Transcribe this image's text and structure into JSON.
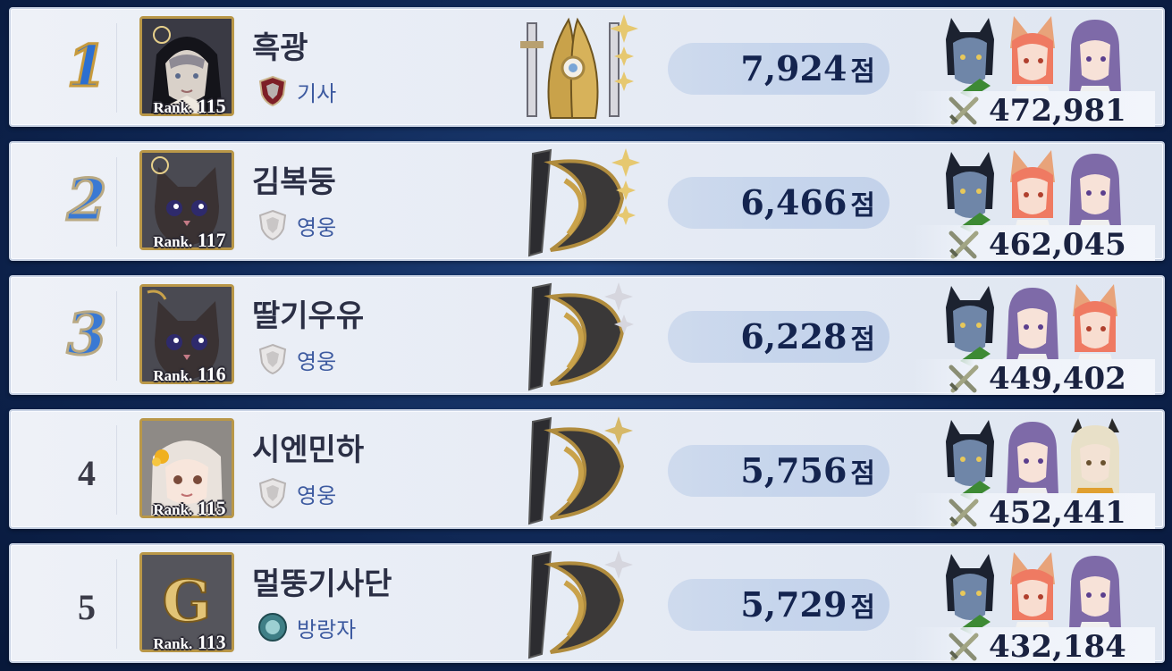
{
  "leaderboard": [
    {
      "rank": "1",
      "rank_label": "Rank.",
      "rank_level": "115",
      "name": "흑광",
      "tier": "기사",
      "score": "7,924",
      "score_unit": "점",
      "power": "472,981",
      "avatar": "nun-portrait",
      "team": [
        "blue-orc",
        "fox-girl",
        "purple-hair-girl"
      ]
    },
    {
      "rank": "2",
      "rank_label": "Rank.",
      "rank_level": "117",
      "name": "김복둥",
      "tier": "영웅",
      "score": "6,466",
      "score_unit": "점",
      "power": "462,045",
      "avatar": "black-cat",
      "team": [
        "blue-orc",
        "fox-girl",
        "purple-hair-girl"
      ]
    },
    {
      "rank": "3",
      "rank_label": "Rank.",
      "rank_level": "116",
      "name": "딸기우유",
      "tier": "영웅",
      "score": "6,228",
      "score_unit": "점",
      "power": "449,402",
      "avatar": "black-cat",
      "team": [
        "blue-orc",
        "purple-hair-girl",
        "fox-girl"
      ]
    },
    {
      "rank": "4",
      "rank_label": "Rank.",
      "rank_level": "115",
      "name": "시엔민하",
      "tier": "영웅",
      "score": "5,756",
      "score_unit": "점",
      "power": "452,441",
      "avatar": "flower-girl",
      "team": [
        "blue-orc",
        "purple-hair-girl",
        "horned-blonde-girl"
      ]
    },
    {
      "rank": "5",
      "rank_label": "Rank.",
      "rank_level": "113",
      "name": "멀뚱기사단",
      "tier": "방랑자",
      "score": "5,729",
      "score_unit": "점",
      "power": "432,184",
      "avatar": "guild-g-emblem",
      "team": [
        "blue-orc",
        "fox-girl",
        "purple-hair-girl"
      ]
    }
  ],
  "colors": {
    "rank_top": "#2c6fd0",
    "rank_border": "#c79a3c",
    "name": "#2b2f45",
    "tier": "#3d5aa0",
    "score": "#14244f"
  }
}
